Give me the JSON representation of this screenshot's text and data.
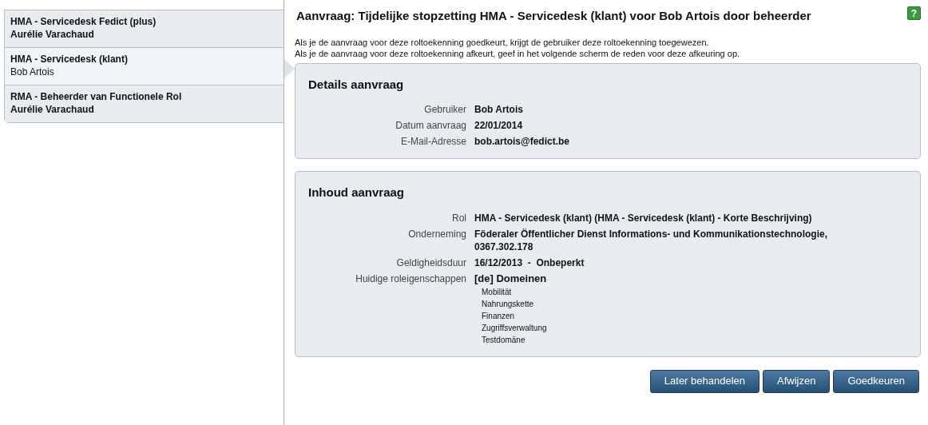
{
  "sidebar": {
    "items": [
      {
        "title": "HMA - Servicedesk Fedict (plus)",
        "name": "Aurélie Varachaud",
        "selected": false
      },
      {
        "title": "HMA - Servicedesk (klant)",
        "name": "Bob Artois",
        "selected": true
      },
      {
        "title": "RMA - Beheerder van Functionele Rol",
        "name": "Aurélie Varachaud",
        "selected": false
      }
    ]
  },
  "title": "Aanvraag: Tijdelijke stopzetting HMA - Servicedesk (klant) voor Bob Artois door beheerder",
  "help_icon": "?",
  "intro": [
    "Als je de aanvraag voor deze roltoekenning goedkeurt, krijgt de gebruiker deze roltoekenning toegewezen.",
    "Als je de aanvraag voor deze roltoekenning afkeurt, geef in het volgende scherm de reden voor deze afkeuring op."
  ],
  "panels": [
    {
      "heading": "Details aanvraag",
      "fields": [
        {
          "label": "Gebruiker",
          "value": [
            "Bob Artois"
          ]
        },
        {
          "label": "Datum aanvraag",
          "value": [
            "22/01/2014"
          ]
        },
        {
          "label": "E-Mail-Adresse",
          "value": [
            "bob.artois@fedict.be"
          ]
        }
      ]
    },
    {
      "heading": "Inhoud aanvraag",
      "fields": [
        {
          "label": "Rol",
          "value": [
            "HMA - Servicedesk (klant) (HMA - Servicedesk (klant) - Korte Beschrijving)"
          ]
        },
        {
          "label": "Onderneming",
          "value": [
            "Föderaler Öffentlicher Dienst Informations- und Kommunikationstechnologie,",
            "0367.302.178"
          ]
        },
        {
          "label": "Geldigheidsduur",
          "value": [
            "16/12/2013  -  Onbeperkt"
          ]
        },
        {
          "label": "Huidige roleigenschappen",
          "group": "[de] Domeinen",
          "items": [
            "Mobilität",
            "Nahrungskette",
            "Finanzen",
            "Zugriffsverwaltung",
            "Testdomäne"
          ]
        }
      ]
    }
  ],
  "buttons": [
    "Later behandelen",
    "Afwijzen",
    "Goedkeuren"
  ]
}
